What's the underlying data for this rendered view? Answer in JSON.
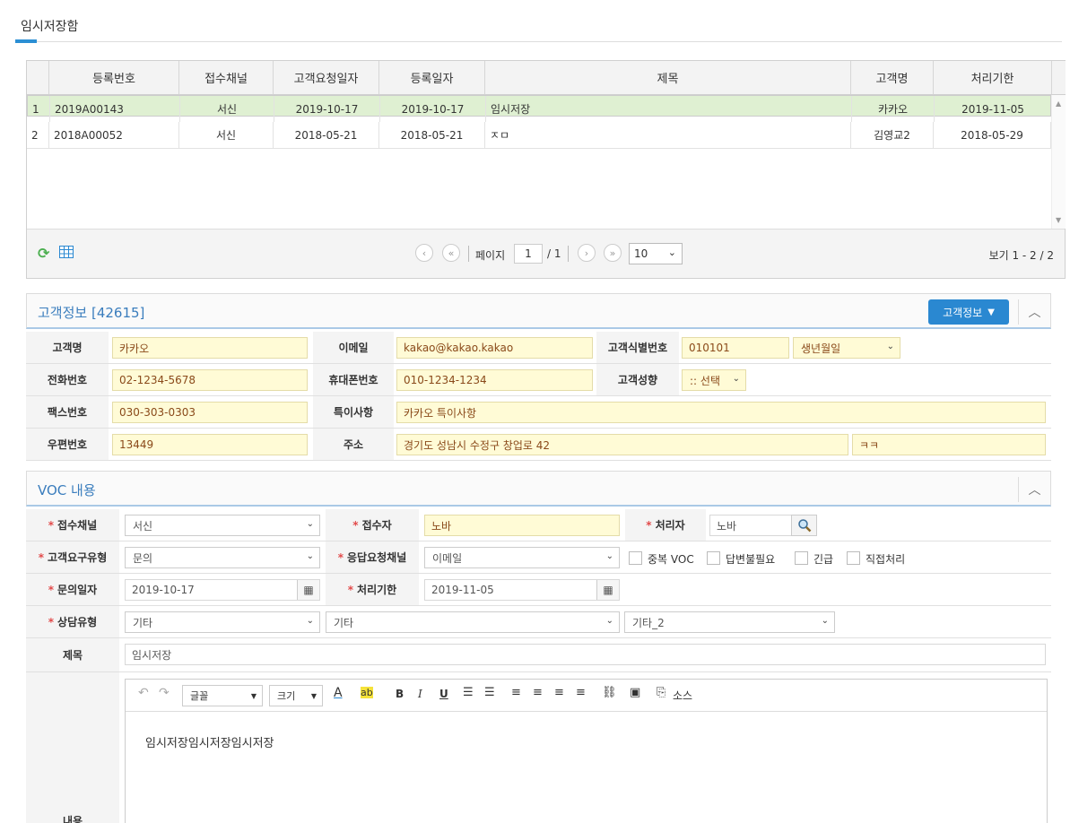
{
  "page": {
    "tab_title": "임시저장함"
  },
  "grid": {
    "headers": [
      "등록번호",
      "접수채널",
      "고객요청일자",
      "등록일자",
      "제목",
      "고객명",
      "처리기한"
    ],
    "rows": [
      {
        "n": "1",
        "id": "2019A00143",
        "channel": "서신",
        "request_date": "2019-10-17",
        "reg_date": "2019-10-17",
        "title": "임시저장",
        "customer": "카카오",
        "deadline": "2019-11-05"
      },
      {
        "n": "2",
        "id": "2018A00052",
        "channel": "서신",
        "request_date": "2018-05-21",
        "reg_date": "2018-05-21",
        "title": "ㅈㅁ",
        "customer": "김영교2",
        "deadline": "2018-05-29"
      }
    ],
    "pager": {
      "page_label": "페이지",
      "page": "1",
      "total_pages": "/ 1",
      "page_size": "10",
      "view_text": "보기 1 - 2 / 2"
    }
  },
  "customer": {
    "title": "고객정보 [42615]",
    "button": "고객정보",
    "labels": {
      "name": "고객명",
      "email": "이메일",
      "id_no": "고객식별번호",
      "phone": "전화번호",
      "mobile": "휴대폰번호",
      "tendency": "고객성향",
      "fax": "팩스번호",
      "notes": "특이사항",
      "zip": "우편번호",
      "address": "주소"
    },
    "values": {
      "name": "카카오",
      "email": "kakao@kakao.kakao",
      "id_no": "010101",
      "birth": "생년월일",
      "phone": "02-1234-5678",
      "mobile": "010-1234-1234",
      "tendency": ":: 선택",
      "fax": "030-303-0303",
      "notes": "카카오 특이사항",
      "zip": "13449",
      "address": "경기도 성남시 수정구 창업로 42",
      "address_detail": "ㅋㅋ"
    }
  },
  "voc": {
    "title": "VOC 내용",
    "labels": {
      "channel": "접수채널",
      "receiver": "접수자",
      "handler": "처리자",
      "req_type": "고객요구유형",
      "resp_channel": "응답요청채널",
      "inq_date": "문의일자",
      "deadline": "처리기한",
      "consult_type": "상담유형",
      "subject": "제목",
      "content": "내용"
    },
    "values": {
      "channel": "서신",
      "receiver": "노바",
      "handler": "노바",
      "req_type": "문의",
      "resp_channel": "이메일",
      "inq_date": "2019-10-17",
      "deadline": "2019-11-05",
      "consult1": "기타",
      "consult2": "기타",
      "consult3": "기타_2",
      "subject": "임시저장",
      "content": "임시저장임시저장임시저장"
    },
    "checkboxes": [
      "중복 VOC",
      "답변불필요",
      "긴급",
      "직접처리"
    ],
    "star": "*"
  },
  "editor": {
    "font": "글꼴",
    "size": "크기",
    "source": "소스"
  }
}
